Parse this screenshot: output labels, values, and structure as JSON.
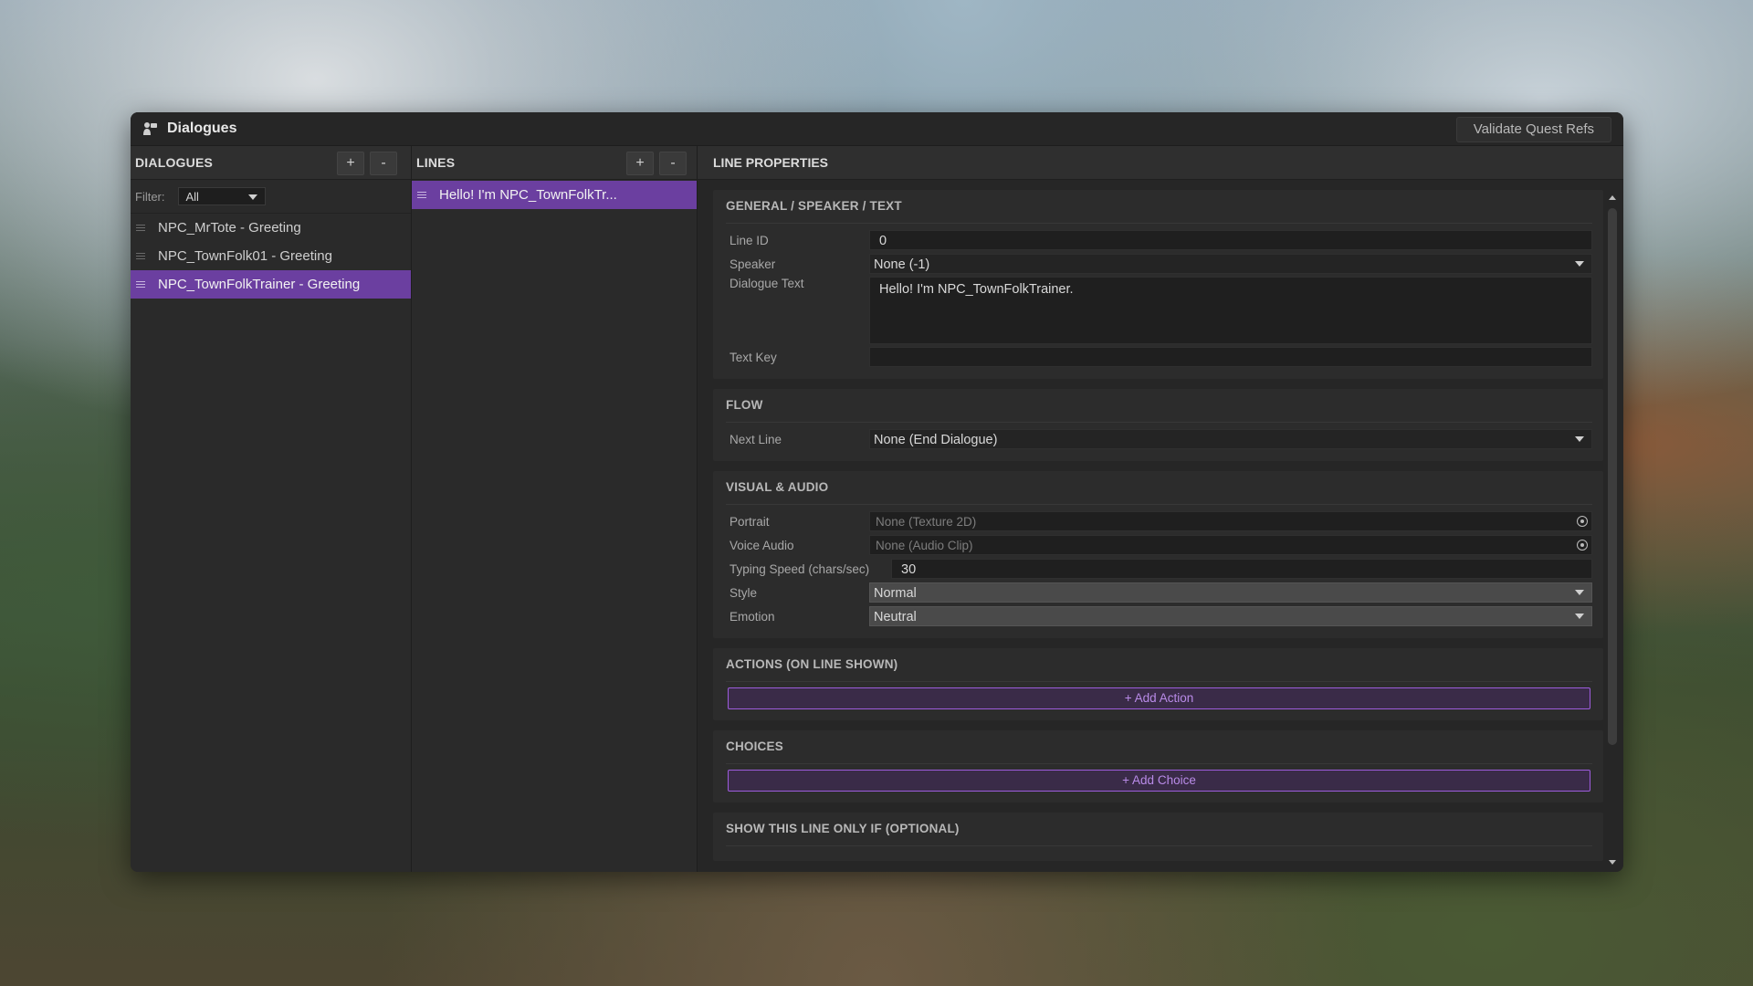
{
  "window": {
    "title": "Dialogues",
    "validate_button": "Validate Quest Refs"
  },
  "dialogues_panel": {
    "header": "DIALOGUES",
    "add": "+",
    "remove": "-",
    "filter_label": "Filter:",
    "filter_value": "All",
    "items": [
      {
        "label": "NPC_MrTote - Greeting",
        "selected": false
      },
      {
        "label": "NPC_TownFolk01 - Greeting",
        "selected": false
      },
      {
        "label": "NPC_TownFolkTrainer - Greeting",
        "selected": true
      }
    ]
  },
  "lines_panel": {
    "header": "LINES",
    "add": "+",
    "remove": "-",
    "items": [
      {
        "label": "Hello! I'm NPC_TownFolkTr...",
        "selected": true
      }
    ]
  },
  "properties": {
    "header": "LINE PROPERTIES",
    "general": {
      "title": "GENERAL / SPEAKER / TEXT",
      "line_id_label": "Line ID",
      "line_id_value": "0",
      "speaker_label": "Speaker",
      "speaker_value": "None (-1)",
      "dialogue_text_label": "Dialogue Text",
      "dialogue_text_value": "Hello! I'm NPC_TownFolkTrainer.",
      "text_key_label": "Text Key",
      "text_key_value": ""
    },
    "flow": {
      "title": "FLOW",
      "next_line_label": "Next Line",
      "next_line_value": "None (End Dialogue)"
    },
    "visual_audio": {
      "title": "VISUAL & AUDIO",
      "portrait_label": "Portrait",
      "portrait_value": "None (Texture 2D)",
      "voice_label": "Voice Audio",
      "voice_value": "None (Audio Clip)",
      "typing_label": "Typing Speed (chars/sec)",
      "typing_value": "30",
      "style_label": "Style",
      "style_value": "Normal",
      "emotion_label": "Emotion",
      "emotion_value": "Neutral"
    },
    "actions": {
      "title": "ACTIONS (ON LINE SHOWN)",
      "add_button": "+ Add Action"
    },
    "choices": {
      "title": "CHOICES",
      "add_button": "+ Add Choice"
    },
    "condition": {
      "title": "SHOW THIS LINE ONLY IF (OPTIONAL)"
    }
  },
  "colors": {
    "accent": "#6b3fa0",
    "button_border": "#9d5cdc"
  }
}
